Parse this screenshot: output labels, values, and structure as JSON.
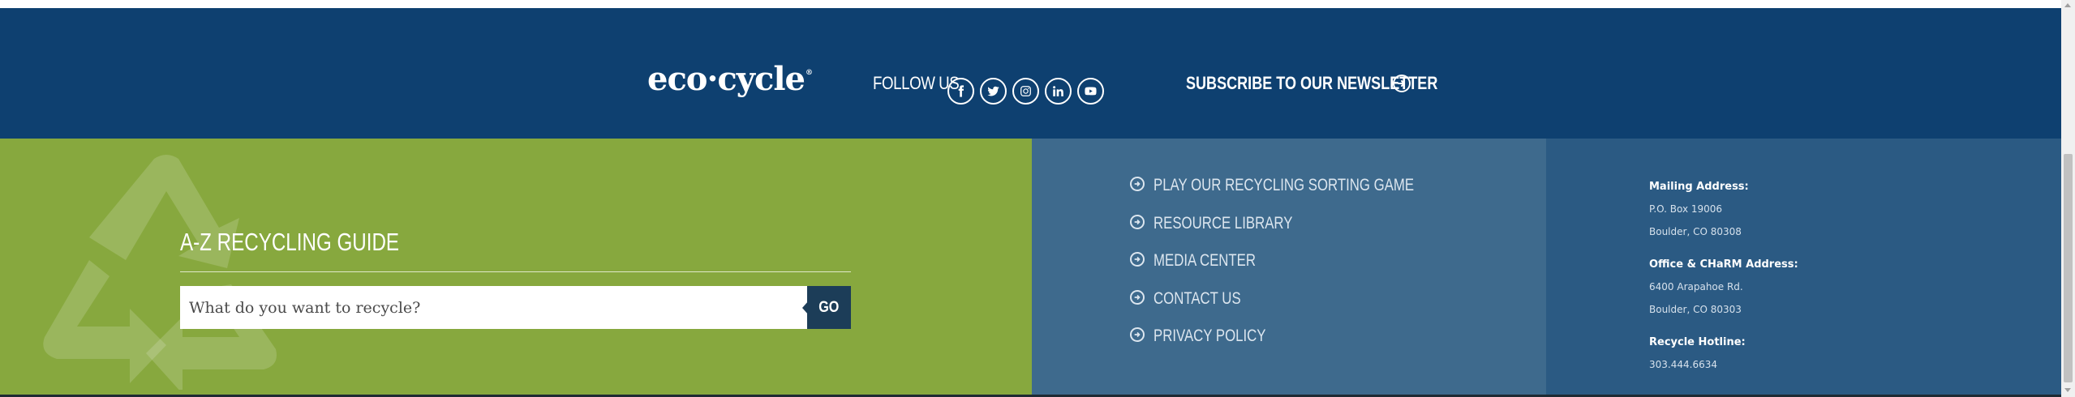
{
  "header": {
    "logo_text": "eco·cycle",
    "logo_mark": "®",
    "follow_label": "FOLLOW US",
    "social_icons": [
      "facebook-icon",
      "twitter-icon",
      "instagram-icon",
      "linkedin-icon",
      "youtube-icon"
    ],
    "subscribe_label": "SUBSCRIBE TO OUR NEWSLETTER",
    "background_color": "#0e4070"
  },
  "recycling_guide": {
    "title": "A-Z RECYCLING GUIDE",
    "search_placeholder": "What do you want to recycle?",
    "search_value": "",
    "go_label": "GO",
    "background_color": "#87a83e"
  },
  "links": {
    "items": [
      {
        "label": "PLAY OUR RECYCLING SORTING GAME"
      },
      {
        "label": "RESOURCE LIBRARY"
      },
      {
        "label": "MEDIA CENTER"
      },
      {
        "label": "CONTACT US"
      },
      {
        "label": "PRIVACY POLICY"
      }
    ],
    "background_color": "#3e6a8d"
  },
  "addresses": {
    "mailing_heading": "Mailing Address:",
    "mailing_line1": "P.O. Box 19006",
    "mailing_line2": "Boulder, CO 80308",
    "office_heading": "Office & CHaRM Address:",
    "office_line1": "6400 Arapahoe Rd.",
    "office_line2": "Boulder, CO 80303",
    "hotline_heading": "Recycle Hotline:",
    "hotline_number": "303.444.6634",
    "background_color": "#2b5a83"
  }
}
